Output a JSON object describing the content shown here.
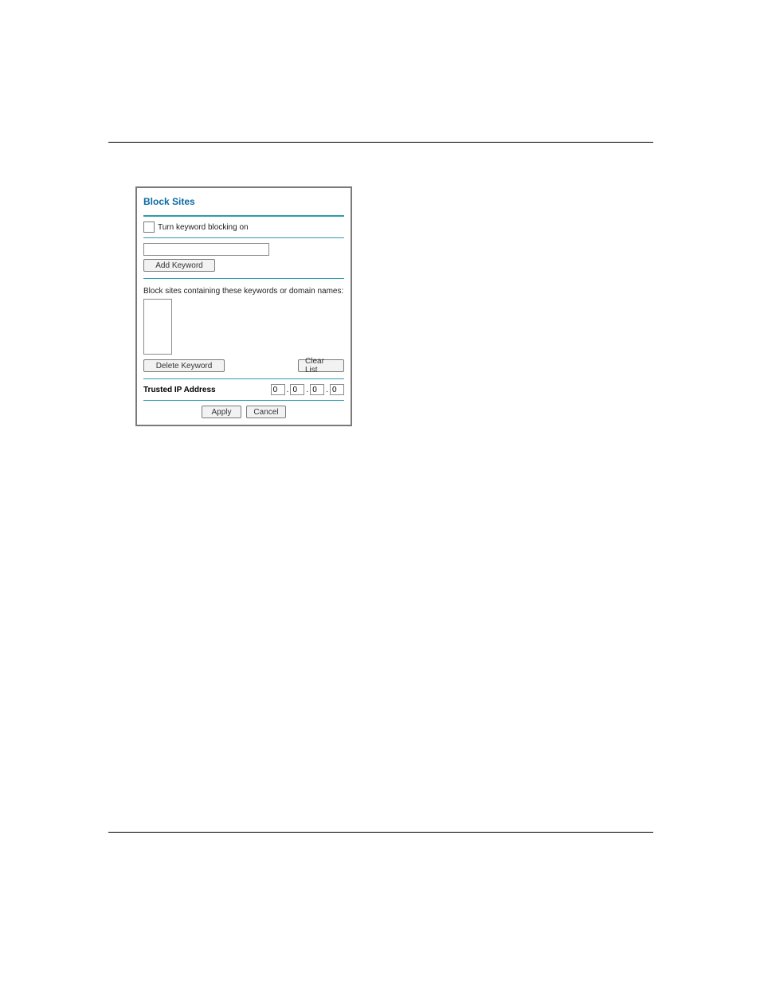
{
  "widget": {
    "title": "Block Sites",
    "keyword_blocking_label": "Turn keyword blocking on",
    "keyword_input_value": "",
    "add_keyword_button": "Add Keyword",
    "list_label": "Block sites containing these keywords or domain names:",
    "delete_keyword_button": "Delete Keyword",
    "clear_list_button": "Clear List",
    "trusted_ip_label": "Trusted IP Address",
    "ip": {
      "a": "0",
      "b": "0",
      "c": "0",
      "d": "0"
    },
    "apply_button": "Apply",
    "cancel_button": "Cancel"
  }
}
